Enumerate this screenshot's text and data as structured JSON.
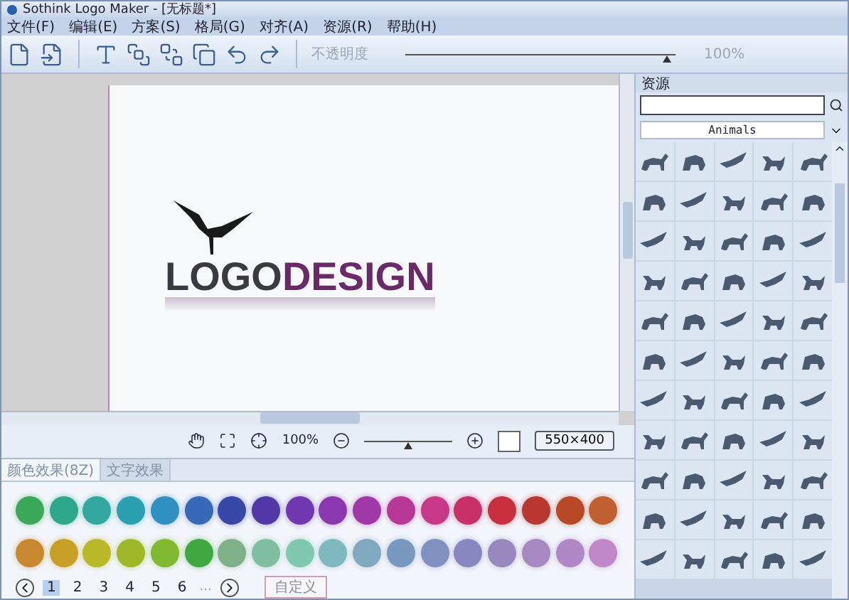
{
  "window": {
    "title": "Sothink Logo Maker - [无标题*]"
  },
  "menu": [
    "文件(F)",
    "编辑(E)",
    "方案(S)",
    "格局(G)",
    "对齐(A)",
    "资源(R)",
    "帮助(H)"
  ],
  "toolbar": {
    "opacity_label": "不透明度",
    "opacity": {
      "level": 0.97
    },
    "opacity_reading": "100%"
  },
  "canvas": {
    "logo": {
      "part_1": "LOGO",
      "part_2": "DESIGN"
    }
  },
  "canvas_toolbar": {
    "zoom_reading": "100%",
    "zoom": {
      "level": 0.5
    },
    "size_button": "550×400"
  },
  "effects": {
    "tabs": [
      {
        "label": "颜色效果(8Z)",
        "selected": true
      },
      {
        "label": "文字效果",
        "selected": false
      }
    ],
    "swatches": [
      {
        "color": "#3aaa5a"
      },
      {
        "color": "#2ea88a"
      },
      {
        "color": "#33a8a0"
      },
      {
        "color": "#2aa0b0"
      },
      {
        "color": "#3090c0"
      },
      {
        "color": "#3868b8"
      },
      {
        "color": "#3848a8"
      },
      {
        "color": "#5038a8"
      },
      {
        "color": "#7038b0"
      },
      {
        "color": "#8a38b0"
      },
      {
        "color": "#a038a8"
      },
      {
        "color": "#b83898"
      },
      {
        "color": "#c83888"
      },
      {
        "color": "#c83068"
      },
      {
        "color": "#c83040"
      },
      {
        "color": "#b83830"
      },
      {
        "color": "#b84828"
      },
      {
        "color": "#c06030"
      },
      {
        "color": "#c88830"
      },
      {
        "color": "#c8a028"
      },
      {
        "color": "#b8b828"
      },
      {
        "color": "#a0b828"
      },
      {
        "color": "#80b830"
      },
      {
        "color": "#40a840"
      },
      {
        "color": "#80b088"
      },
      {
        "color": "#80c0a0"
      },
      {
        "color": "#80c8b0"
      },
      {
        "color": "#80b8c0"
      },
      {
        "color": "#80a8c0"
      },
      {
        "color": "#7898c0"
      },
      {
        "color": "#8090c0"
      },
      {
        "color": "#8888c0"
      },
      {
        "color": "#9888c0"
      },
      {
        "color": "#a888c0"
      },
      {
        "color": "#b088c8"
      },
      {
        "color": "#c088c8"
      }
    ],
    "pages": [
      {
        "label": "1",
        "selected": true
      },
      {
        "label": "2",
        "selected": false
      },
      {
        "label": "3",
        "selected": false
      },
      {
        "label": "4",
        "selected": false
      },
      {
        "label": "5",
        "selected": false
      },
      {
        "label": "6",
        "selected": false
      }
    ],
    "ellipsis": "...",
    "custom_button": "自定义"
  },
  "resources": {
    "title": "资源",
    "category": "Animals"
  }
}
